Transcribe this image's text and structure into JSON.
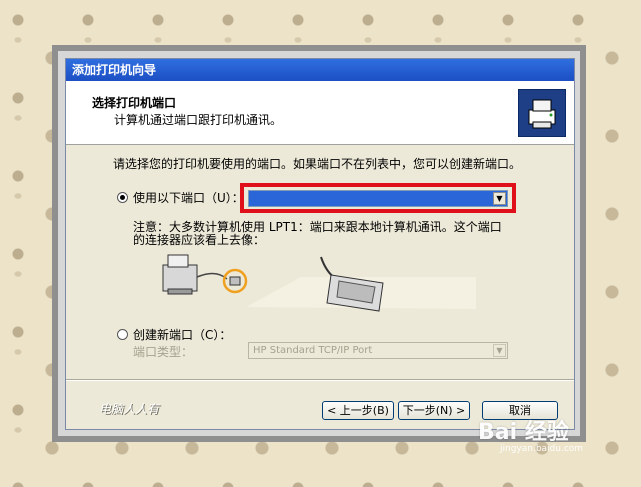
{
  "dialog": {
    "title": "添加打印机向导",
    "header_title": "选择打印机端口",
    "header_subtitle": "计算机通过端口跟打印机通讯。",
    "wizard_icon": "printer-wizard-icon"
  },
  "main": {
    "instruction": "请选择您的打印机要使用的端口。如果端口不在列表中，您可以创建新端口。",
    "use_port": {
      "label": "使用以下端口（U）：",
      "selected": true,
      "combo_value": ""
    },
    "note_line1": "注意：大多数计算机使用 LPT1：端口来跟本地计算机通讯。这个端口",
    "note_line2": "的连接器应该看上去像：",
    "new_port": {
      "label": "创建新端口（C）：",
      "selected": false,
      "type_label": "端口类型：",
      "type_value": "HP Standard TCP/IP Port"
    }
  },
  "buttons": {
    "back": "< 上一步(B)",
    "next": "下一步(N) >",
    "cancel": "取消"
  },
  "watermarks": {
    "corner": "电脑人人有",
    "baidu": "Bai 经验",
    "baidu_url": "jingyan.baidu.com"
  },
  "colors": {
    "title_bar": "#1c4fc4",
    "highlight_box": "#e0101a",
    "combo_selected": "#2a66d8"
  }
}
